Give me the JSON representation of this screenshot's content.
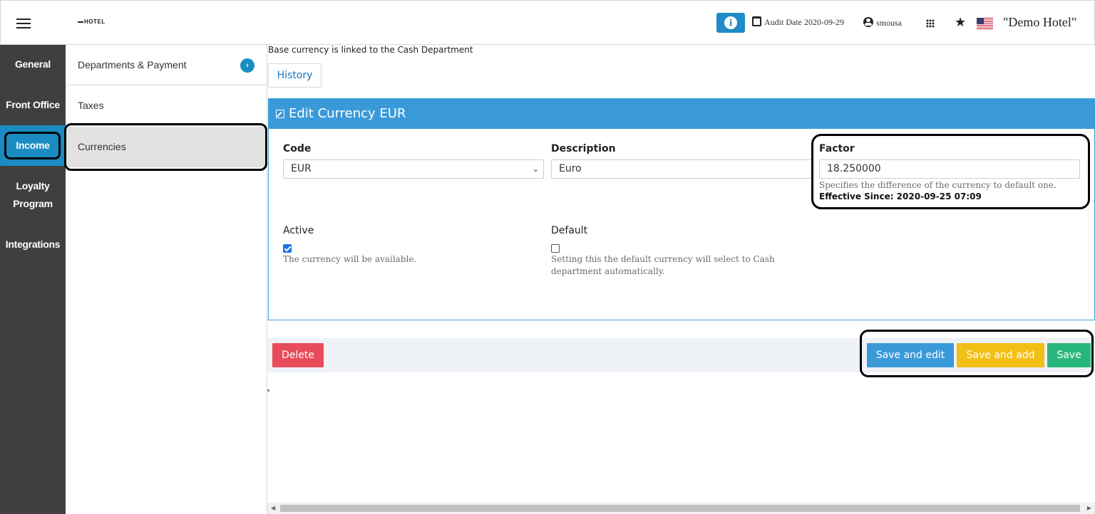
{
  "topbar": {
    "logo": "HOTEL",
    "info_glyph": "i",
    "audit_date": "Audit Date 2020-09-29",
    "username": "smousa",
    "hotel_name": "\"Demo Hotel\"",
    "icons": [
      "menu-icon",
      "info-icon",
      "calendar-icon",
      "user-circle-icon",
      "apps-grid-icon",
      "star-icon",
      "us-flag-icon"
    ]
  },
  "sidebar": {
    "items": [
      {
        "label": "General"
      },
      {
        "label": "Front Office"
      },
      {
        "label": "Income",
        "active": true
      },
      {
        "label": "Loyalty Program"
      },
      {
        "label": "Integrations"
      }
    ],
    "active_color": "#1b8cc3"
  },
  "submenu": {
    "items": [
      {
        "label": "Departments & Payment",
        "chevron": "›"
      },
      {
        "label": "Taxes"
      },
      {
        "label": "Currencies",
        "active": true
      }
    ]
  },
  "main": {
    "base_note": "Base currency is linked to the Cash Department",
    "history_label": "History",
    "panel_title": "Edit Currency EUR",
    "fields": {
      "code_label": "Code",
      "code_value": "EUR",
      "description_label": "Description",
      "description_value": "Euro",
      "factor_label": "Factor",
      "factor_value": "18.250000",
      "factor_help": "Specifies the difference of the currency to default one.",
      "factor_effective": "Effective Since: 2020-09-25 07:09",
      "active_label": "Active",
      "active_checked": true,
      "active_help": "The currency will be available.",
      "default_label": "Default",
      "default_checked": false,
      "default_help_line1": "Setting this the default currency will select to Cash",
      "default_help_line2": "department automatically."
    },
    "actions": {
      "delete": "Delete",
      "save_and_edit": "Save and edit",
      "save_and_add": "Save and add",
      "save": "Save"
    }
  },
  "colors": {
    "header_blue": "#3a9ad9",
    "delete_red": "#e84c5a",
    "save_add_yellow": "#f2bf17",
    "save_green": "#28b77b",
    "sidebar_dark": "#3f3f3f"
  }
}
